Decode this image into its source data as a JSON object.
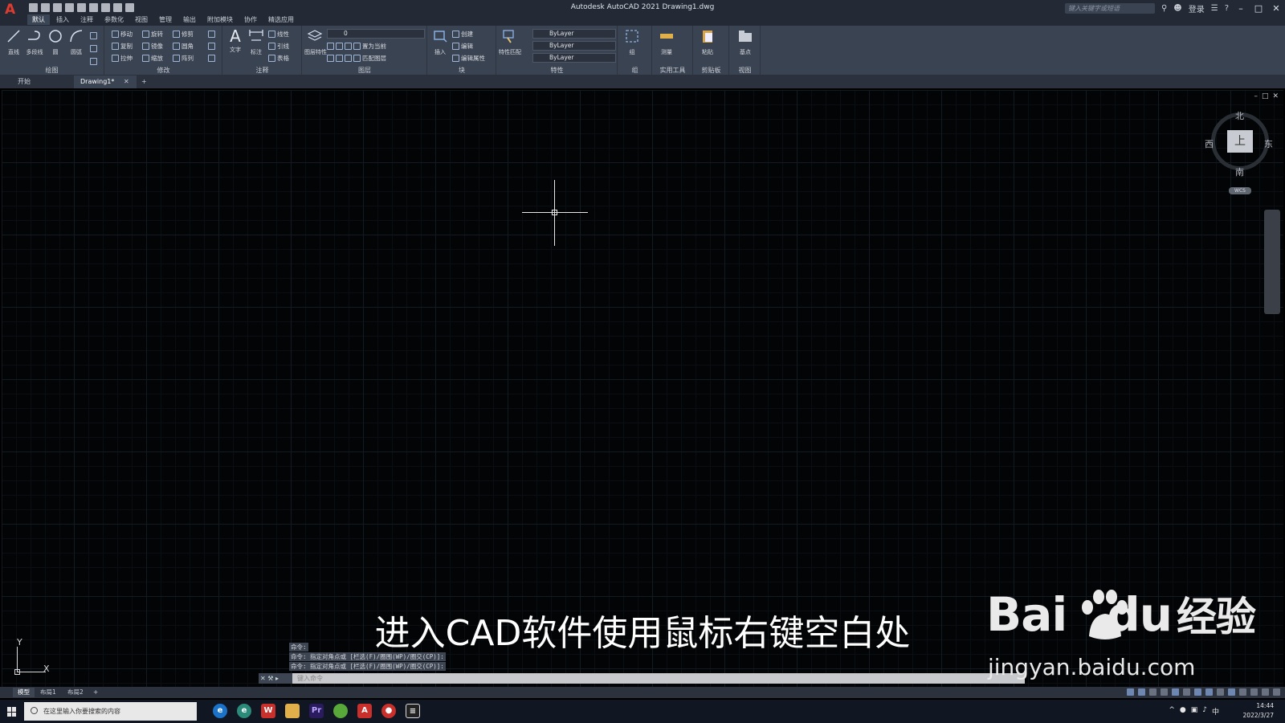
{
  "app": {
    "logo_letter": "A",
    "window_title": "Autodesk AutoCAD 2021    Drawing1.dwg",
    "search_placeholder": "键入关键字或短语",
    "login_label": "登录"
  },
  "ribbon_tabs": [
    "默认",
    "插入",
    "注释",
    "参数化",
    "视图",
    "管理",
    "输出",
    "附加模块",
    "协作",
    "精选应用"
  ],
  "ribbon": {
    "draw": {
      "title": "绘图",
      "line": "直线",
      "polyline": "多段线",
      "circle": "圆",
      "arc": "圆弧"
    },
    "modify": {
      "title": "修改",
      "move": "移动",
      "rotate": "旋转",
      "trim": "修剪",
      "copy": "复制",
      "mirror": "镜像",
      "fillet": "圆角",
      "stretch": "拉伸",
      "scale": "缩放",
      "array": "阵列"
    },
    "annotation": {
      "title": "注释",
      "text": "文字",
      "dimension": "标注",
      "linear": "线性",
      "leader": "引线",
      "table": "表格"
    },
    "layers": {
      "title": "图层",
      "layer_props": "图层特性",
      "current_layer": "0",
      "set_current": "置为当前",
      "match_layer": "匹配图层"
    },
    "block": {
      "title": "块",
      "insert": "插入",
      "create": "创建",
      "edit": "编辑",
      "edit_attr": "编辑属性"
    },
    "properties": {
      "title": "特性",
      "match": "特性匹配",
      "color": "ByLayer",
      "linetype": "ByLayer",
      "lineweight": "ByLayer"
    },
    "groups": {
      "title": "组",
      "group": "组"
    },
    "utilities": {
      "title": "实用工具",
      "measure": "测量"
    },
    "clipboard": {
      "title": "剪贴板",
      "paste": "粘贴"
    },
    "view": {
      "title": "视图",
      "base": "基点"
    }
  },
  "file_tabs": {
    "start": "开始",
    "drawing": "Drawing1*"
  },
  "viewcube": {
    "north": "北",
    "south": "南",
    "east": "东",
    "west": "西",
    "face": "上",
    "wcs": "WCS"
  },
  "ucs": {
    "x": "X",
    "y": "Y"
  },
  "command": {
    "history": [
      "命令:",
      "命令: 指定对角点或 [栏选(F)/圈围(WP)/圈交(CP)]:",
      "命令: 指定对角点或 [栏选(F)/圈围(WP)/圈交(CP)]:"
    ],
    "placeholder": "键入命令"
  },
  "layout_tabs": [
    "模型",
    "布局1",
    "布局2"
  ],
  "subtitle": "进入CAD软件使用鼠标右键空白处",
  "watermark": {
    "brand": "Bai",
    "brand_du": "du",
    "cn": "经验",
    "url": "jingyan.baidu.com"
  },
  "taskbar": {
    "search_placeholder": "在这里输入你要搜索的内容",
    "time": "14:44",
    "date": "2022/3/27",
    "ime": "中"
  },
  "colors": {
    "accent_red": "#e03b2f",
    "ribbon_bg": "#3a4352",
    "canvas_bg": "#030405"
  }
}
